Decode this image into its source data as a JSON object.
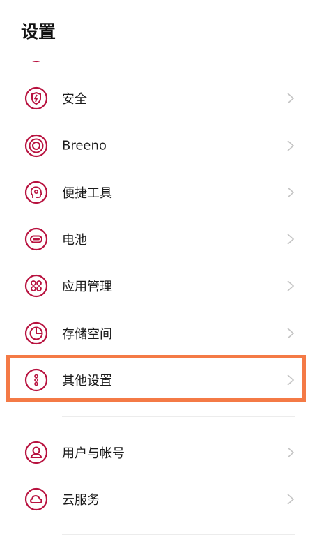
{
  "header": {
    "title": "设置"
  },
  "colors": {
    "accent": "#b8123f",
    "highlight": "#f47a46"
  },
  "items": [
    {
      "label": "安全",
      "icon": "security-icon"
    },
    {
      "label": "Breeno",
      "icon": "breeno-icon"
    },
    {
      "label": "便捷工具",
      "icon": "convenience-tools-icon"
    },
    {
      "label": "电池",
      "icon": "battery-icon"
    },
    {
      "label": "应用管理",
      "icon": "app-management-icon"
    },
    {
      "label": "存储空间",
      "icon": "storage-icon"
    },
    {
      "label": "其他设置",
      "icon": "more-settings-icon",
      "highlighted": true
    },
    {
      "label": "用户与帐号",
      "icon": "user-account-icon"
    },
    {
      "label": "云服务",
      "icon": "cloud-icon"
    }
  ]
}
